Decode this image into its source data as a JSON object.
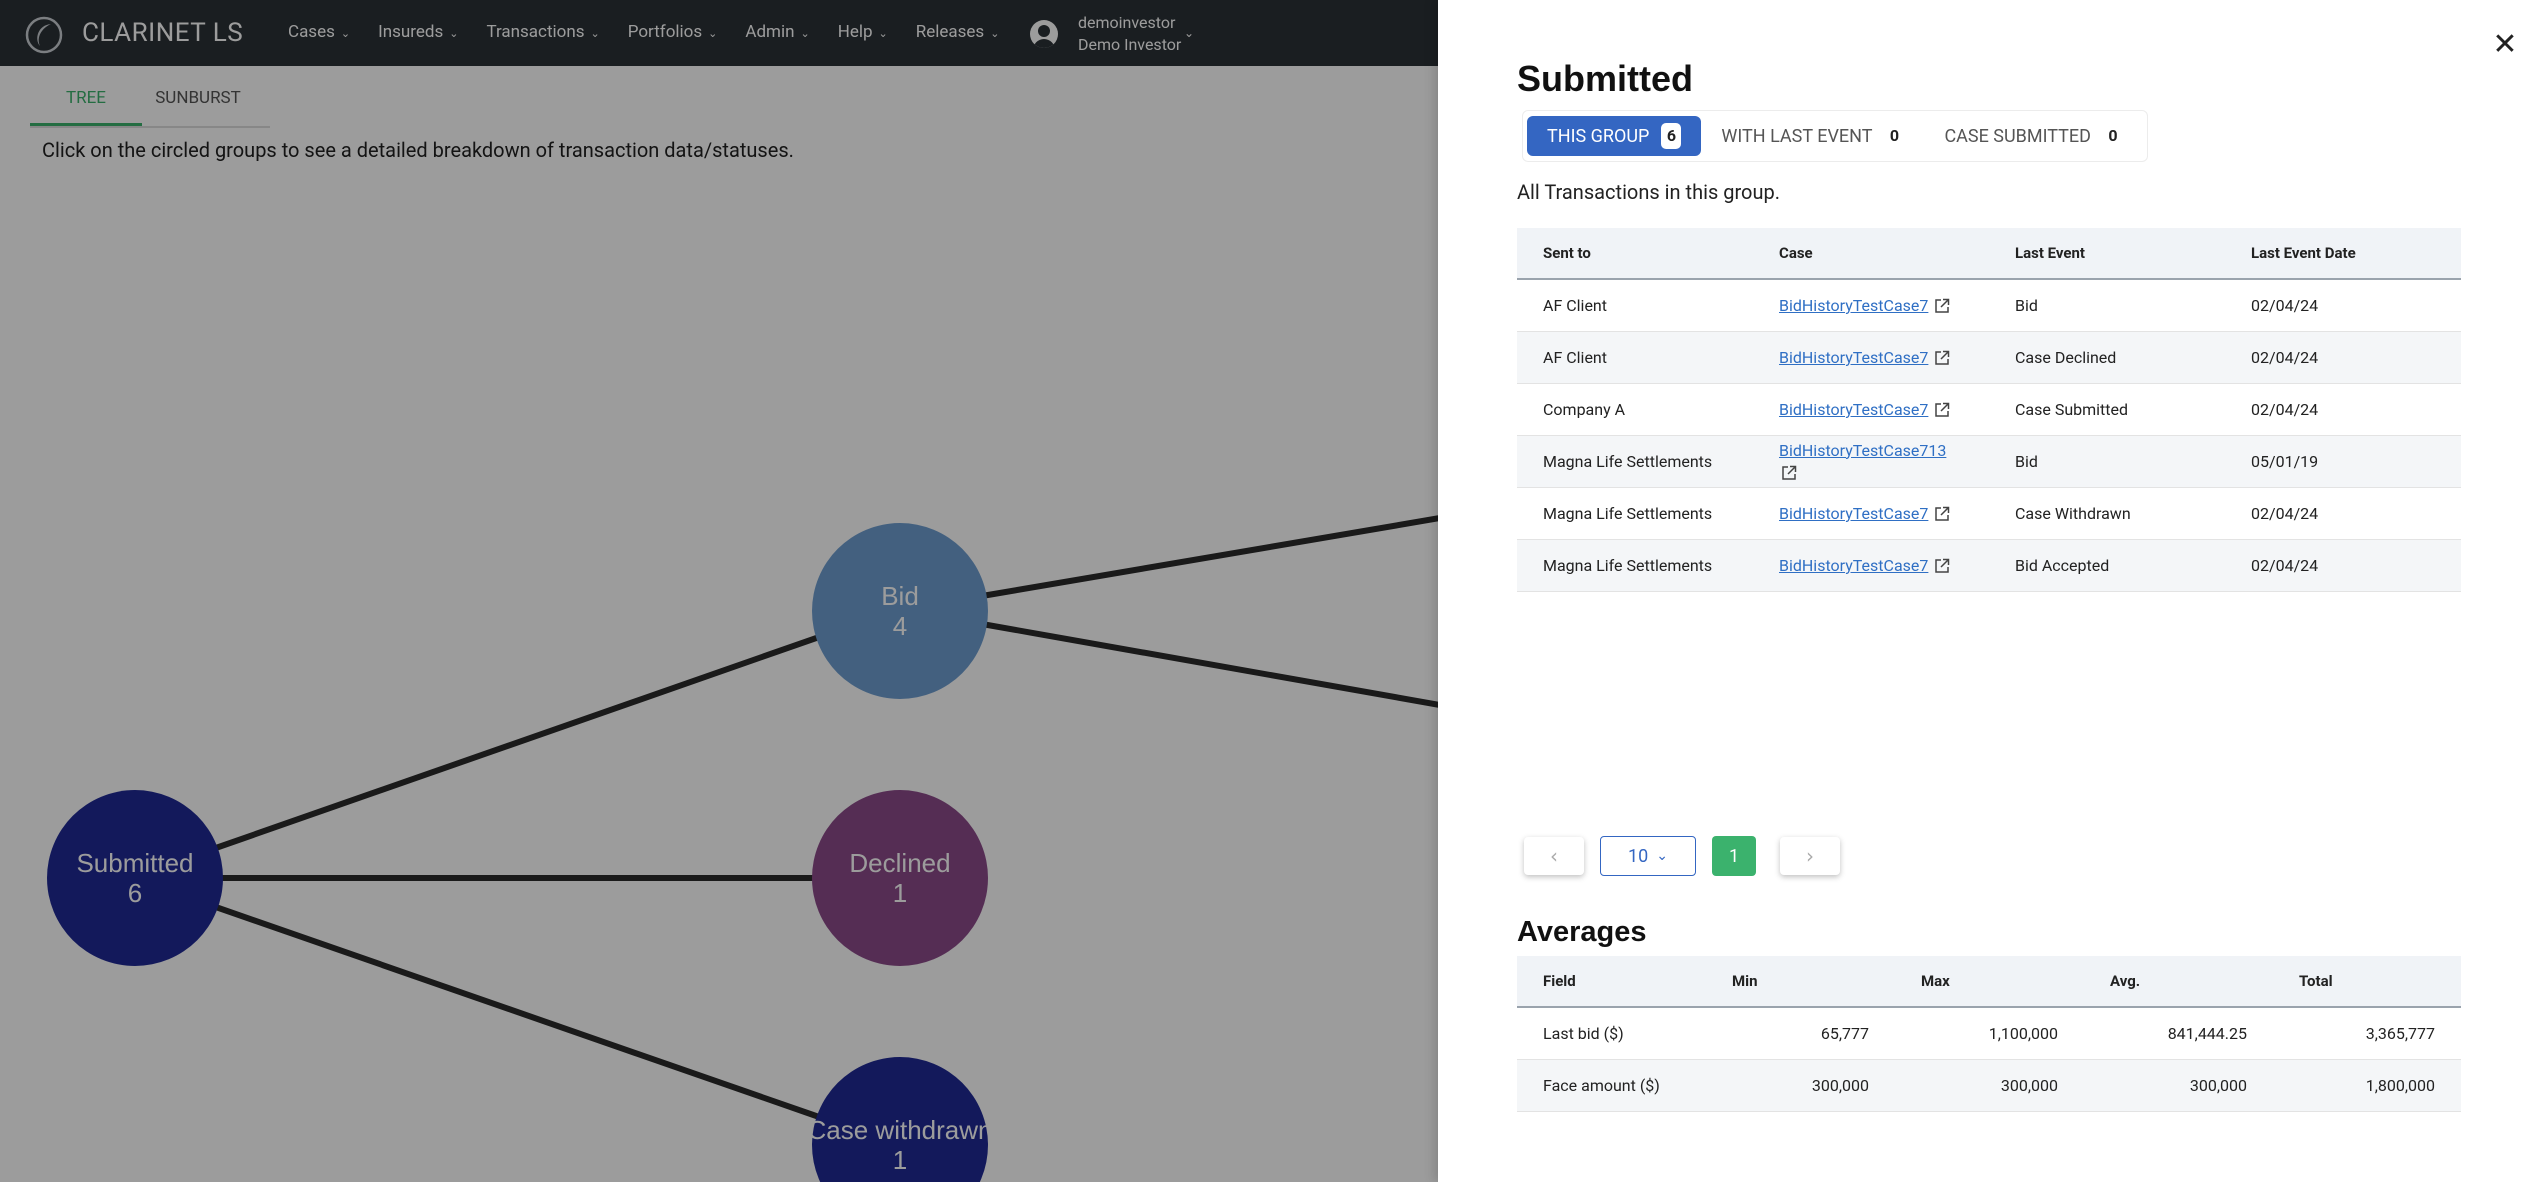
{
  "app": {
    "brand": "CLARINET LS",
    "nav": [
      "Cases",
      "Insureds",
      "Transactions",
      "Portfolios",
      "Admin",
      "Help",
      "Releases"
    ],
    "user": {
      "username": "demoinvestor",
      "display_name": "Demo Investor"
    },
    "tabs": [
      {
        "label": "TREE",
        "active": true
      },
      {
        "label": "SUNBURST",
        "active": false
      }
    ],
    "hint": "Click on the circled groups to see a detailed breakdown of transaction data/statuses."
  },
  "tree": {
    "nodes": [
      {
        "id": "submitted",
        "label": "Submitted",
        "count": "6",
        "color": "#1f2a96"
      },
      {
        "id": "bid",
        "label": "Bid",
        "count": "4",
        "color": "#6e9ed0"
      },
      {
        "id": "declined",
        "label": "Declined",
        "count": "1",
        "color": "#8c4a8a"
      },
      {
        "id": "case-withdrawn",
        "label": "Case withdrawn",
        "count": "1",
        "color": "#1f2a96"
      }
    ]
  },
  "drawer": {
    "title": "Submitted",
    "segments": [
      {
        "label": "THIS GROUP",
        "count": "6",
        "active": true
      },
      {
        "label": "WITH LAST EVENT",
        "count": "0",
        "active": false
      },
      {
        "label": "CASE SUBMITTED",
        "count": "0",
        "active": false
      }
    ],
    "subtitle": "All Transactions in this group.",
    "table": {
      "headers": [
        "Sent to",
        "Case",
        "Last Event",
        "Last Event Date"
      ],
      "rows": [
        {
          "sent_to": "AF Client",
          "case": "BidHistoryTestCase7",
          "last_event": "Bid",
          "date": "02/04/24"
        },
        {
          "sent_to": "AF Client",
          "case": "BidHistoryTestCase7",
          "last_event": "Case Declined",
          "date": "02/04/24"
        },
        {
          "sent_to": "Company A",
          "case": "BidHistoryTestCase7",
          "last_event": "Case Submitted",
          "date": "02/04/24"
        },
        {
          "sent_to": "Magna Life Settlements",
          "case": "BidHistoryTestCase713",
          "last_event": "Bid",
          "date": "05/01/19"
        },
        {
          "sent_to": "Magna Life Settlements",
          "case": "BidHistoryTestCase7",
          "last_event": "Case Withdrawn",
          "date": "02/04/24"
        },
        {
          "sent_to": "Magna Life Settlements",
          "case": "BidHistoryTestCase7",
          "last_event": "Bid Accepted",
          "date": "02/04/24"
        }
      ]
    },
    "pagination": {
      "page_size": "10",
      "current_page": "1"
    },
    "averages": {
      "title": "Averages",
      "headers": [
        "Field",
        "Min",
        "Max",
        "Avg.",
        "Total"
      ],
      "rows": [
        {
          "field": "Last bid ($)",
          "min": "65,777",
          "max": "1,100,000",
          "avg": "841,444.25",
          "total": "3,365,777"
        },
        {
          "field": "Face amount ($)",
          "min": "300,000",
          "max": "300,000",
          "avg": "300,000",
          "total": "1,800,000"
        }
      ]
    }
  }
}
